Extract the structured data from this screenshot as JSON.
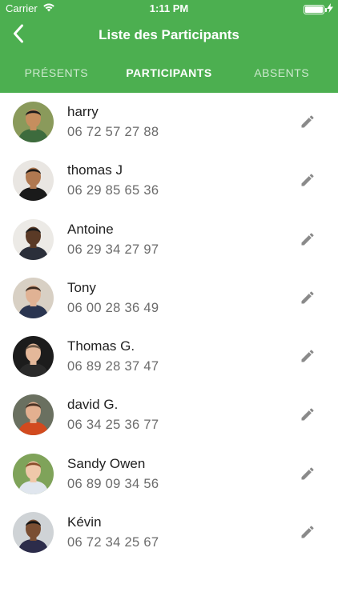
{
  "status_bar": {
    "carrier": "Carrier",
    "time": "1:11 PM",
    "battery_level": 1.0
  },
  "nav": {
    "title": "Liste des Participants",
    "back_icon": "chevron-left-icon"
  },
  "tabs": [
    {
      "label": "PRÉSENTS",
      "active": false
    },
    {
      "label": "PARTICIPANTS",
      "active": true
    },
    {
      "label": "ABSENTS",
      "active": false
    }
  ],
  "participants": [
    {
      "name": "harry",
      "phone": "06 72 57 27 88"
    },
    {
      "name": "thomas J",
      "phone": "06 29 85 65 36"
    },
    {
      "name": "Antoine",
      "phone": "06 29 34 27 97"
    },
    {
      "name": "Tony",
      "phone": "06 00 28 36 49"
    },
    {
      "name": "Thomas G.",
      "phone": "06 89 28 37 47"
    },
    {
      "name": "david G.",
      "phone": "06 34 25 36 77"
    },
    {
      "name": "Sandy Owen",
      "phone": "06 89 09 34 56"
    },
    {
      "name": "Kévin",
      "phone": "06 72 34 25 67"
    }
  ],
  "colors": {
    "header_green": "#4caf50",
    "edit_icon_gray": "#8a8a8a"
  },
  "icons": {
    "edit": "pencil-icon",
    "wifi": "wifi-icon",
    "battery": "battery-icon",
    "charging": "bolt-icon"
  }
}
